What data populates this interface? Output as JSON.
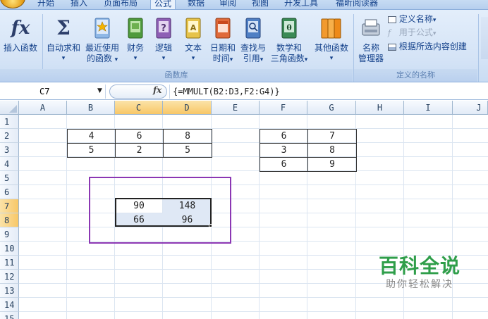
{
  "ribbon_tabs": [
    {
      "label": "开始"
    },
    {
      "label": "插入"
    },
    {
      "label": "页面布局"
    },
    {
      "label": "公式",
      "active": true
    },
    {
      "label": "数据"
    },
    {
      "label": "审阅"
    },
    {
      "label": "视图"
    },
    {
      "label": "开发工具"
    },
    {
      "label": "福昕阅读器"
    }
  ],
  "ribbon": {
    "insert_function": {
      "line1": "插入函数",
      "icon": "fx-icon"
    },
    "autosum": {
      "line1": "自动求和",
      "icon": "sigma-icon",
      "arrow": "▾"
    },
    "recent": {
      "line1": "最近使用",
      "line2": "的函数",
      "arrow": "▾"
    },
    "financial": {
      "line1": "财务",
      "arrow": "▾"
    },
    "logical": {
      "line1": "逻辑",
      "arrow": "▾"
    },
    "text": {
      "line1": "文本",
      "arrow": "▾"
    },
    "datetime": {
      "line1": "日期和",
      "line2": "时间",
      "arrow": "▾"
    },
    "lookup": {
      "line1": "查找与",
      "line2": "引用",
      "arrow": "▾"
    },
    "math": {
      "line1": "数学和",
      "line2": "三角函数",
      "arrow": "▾"
    },
    "other": {
      "line1": "其他函数",
      "arrow": "▾"
    },
    "name_manager": {
      "line1": "名称",
      "line2": "管理器"
    },
    "define_name": {
      "label": "定义名称",
      "arrow": "▾"
    },
    "use_in_formula": {
      "label": "用于公式",
      "arrow": "▾"
    },
    "create_from_selection": {
      "label": "根据所选内容创建"
    },
    "group_function_library": "函数库",
    "group_defined_names": "定义的名称"
  },
  "formula_bar": {
    "name_box": "C7",
    "fx": "fx",
    "formula": "{=MMULT(B2:D3,F2:G4)}"
  },
  "columns": [
    "A",
    "B",
    "C",
    "D",
    "E",
    "F",
    "G",
    "H",
    "I",
    "J"
  ],
  "rows": [
    "1",
    "2",
    "3",
    "4",
    "5",
    "6",
    "7",
    "8",
    "9",
    "10",
    "11",
    "12",
    "13",
    "14",
    "15"
  ],
  "cells": {
    "B2": "4",
    "C2": "6",
    "D2": "8",
    "B3": "5",
    "C3": "2",
    "D3": "5",
    "F2": "6",
    "G2": "7",
    "F3": "3",
    "G3": "8",
    "F4": "6",
    "G4": "9",
    "C7": "90",
    "D7": "148",
    "C8": "66",
    "D8": "96"
  },
  "watermark": {
    "title": "百科全说",
    "subtitle": "助你轻松解决"
  }
}
